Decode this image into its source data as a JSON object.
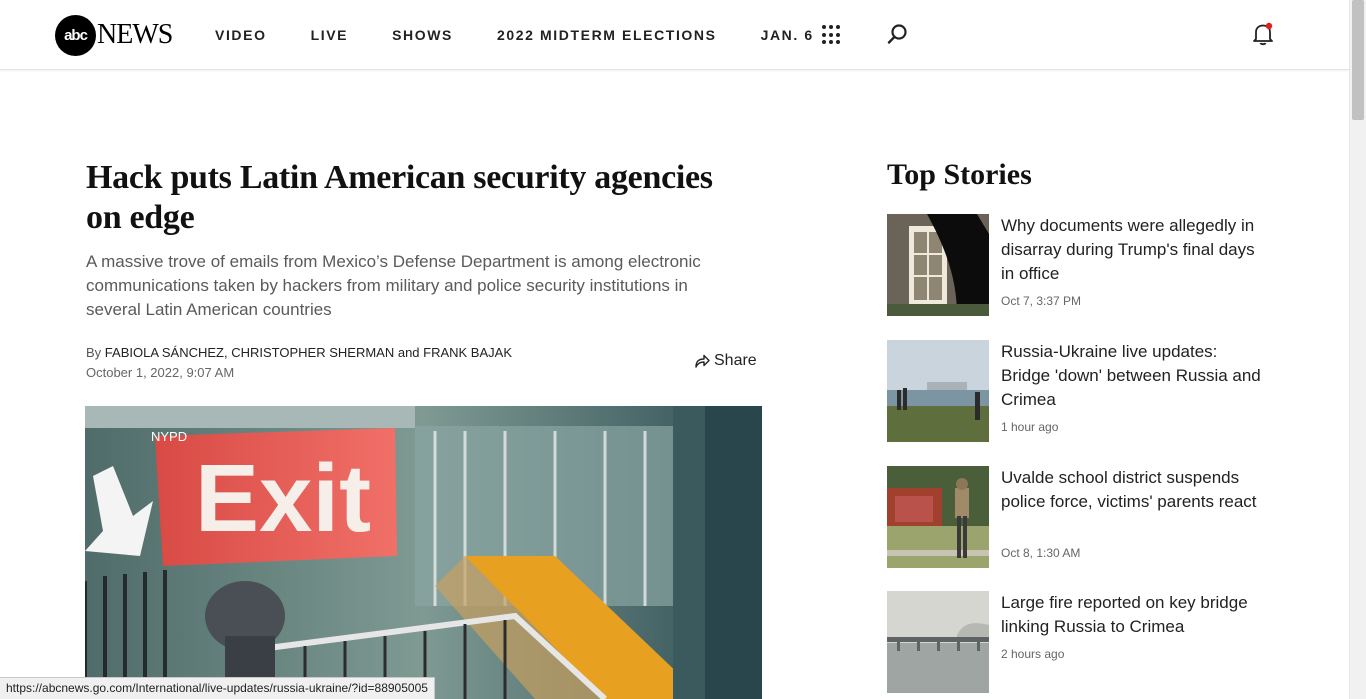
{
  "header": {
    "logo_abc": "abc",
    "logo_news": "NEWS",
    "nav": [
      "VIDEO",
      "LIVE",
      "SHOWS",
      "2022 MIDTERM ELECTIONS",
      "JAN. 6"
    ]
  },
  "article": {
    "headline": "Hack puts Latin American security agencies on edge",
    "dek": "A massive trove of emails from Mexico’s Defense Department is among electronic communications taken by hackers from military and police security institutions in several Latin American countries",
    "by_prefix": "By",
    "authors": "FABIOLA SÁNCHEZ, CHRISTOPHER SHERMAN and FRANK BAJAK",
    "date": "October 1, 2022, 9:07 AM",
    "share_label": "Share",
    "image_label": "NYPD",
    "image_sign": "Exit"
  },
  "top_stories": {
    "heading": "Top Stories",
    "items": [
      {
        "title": "Why documents were allegedly in disarray during Trump's final days in office",
        "time": "Oct 7, 3:37 PM"
      },
      {
        "title": "Russia-Ukraine live updates: Bridge 'down' between Russia and Crimea",
        "time": "1 hour ago"
      },
      {
        "title": "Uvalde school district suspends police force, victims' parents react",
        "time": "Oct 8, 1:30 AM"
      },
      {
        "title": "Large fire reported on key bridge linking Russia to Crimea",
        "time": "2 hours ago"
      }
    ]
  },
  "status_url": "https://abcnews.go.com/International/live-updates/russia-ukraine/?id=88905005",
  "colors": {
    "notification_dot": "#e0201b",
    "text_muted": "#5a5a5a"
  }
}
